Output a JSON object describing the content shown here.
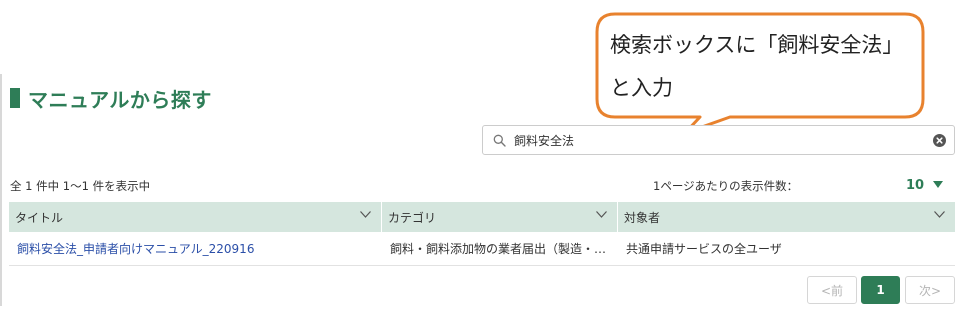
{
  "annotation": {
    "line1": "検索ボックスに「飼料安全法」",
    "line2": "と入力"
  },
  "page": {
    "title": "マニュアルから探す"
  },
  "search": {
    "value": "飼料安全法"
  },
  "results": {
    "count_text": "全 1 件中 1〜1 件を表示中",
    "per_page_label": "1ページあたりの表示件数：",
    "per_page_value": "10"
  },
  "table": {
    "headers": [
      "タイトル",
      "カテゴリ",
      "対象者"
    ],
    "rows": [
      {
        "title": "飼料安全法_申請者向けマニュアル_220916",
        "category": "飼料・飼料添加物の業者届出（製造・輸入・販売）",
        "target": "共通申請サービスの全ユーザ"
      }
    ]
  },
  "pagination": {
    "prev": "<前",
    "current": "1",
    "next": "次>"
  },
  "colors": {
    "accent": "#2e7d57",
    "header_bg": "#d5e6de",
    "link": "#2b4fa8",
    "callout_border": "#e8822e"
  }
}
